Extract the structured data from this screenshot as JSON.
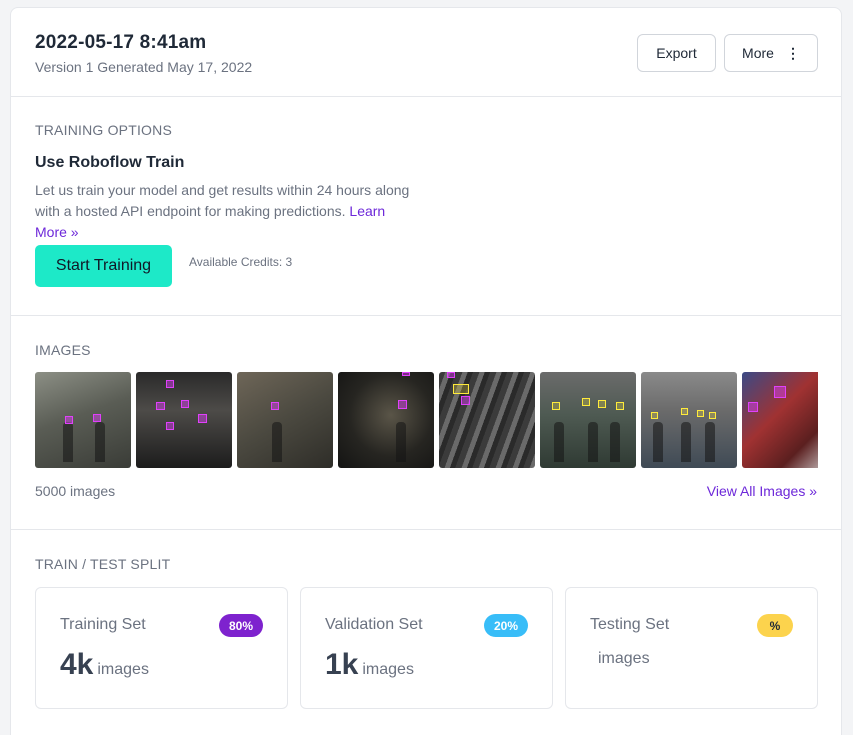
{
  "header": {
    "title": "2022-05-17 8:41am",
    "subtitle": "Version 1 Generated May 17, 2022",
    "export_label": "Export",
    "more_label": "More",
    "more_icon": "⋮"
  },
  "training": {
    "section_label": "TRAINING OPTIONS",
    "heading": "Use Roboflow Train",
    "description": "Let us train your model and get results within 24 hours along with a hosted API endpoint for making predictions. ",
    "learn_more": "Learn More »",
    "start_button": "Start Training",
    "credits": "Available Credits: 3"
  },
  "images": {
    "section_label": "IMAGES",
    "count": "5000 images",
    "view_all": "View All Images »",
    "thumbnails": [
      "thumbnail-1",
      "thumbnail-2",
      "thumbnail-3",
      "thumbnail-4",
      "thumbnail-5",
      "thumbnail-6",
      "thumbnail-7",
      "thumbnail-8"
    ]
  },
  "split": {
    "section_label": "TRAIN / TEST SPLIT",
    "training": {
      "name": "Training Set",
      "percent": "80%",
      "count": "4k",
      "unit": "images",
      "color": "#7e22ce"
    },
    "validation": {
      "name": "Validation Set",
      "percent": "20%",
      "count": "1k",
      "unit": "images",
      "color": "#38bdf8"
    },
    "testing": {
      "name": "Testing Set",
      "percent": "%",
      "count": "",
      "unit": "images",
      "color": "#fcd34d"
    }
  },
  "colors": {
    "accent": "#1de9c8",
    "link": "#6d28d9",
    "border": "#e5e7eb"
  }
}
